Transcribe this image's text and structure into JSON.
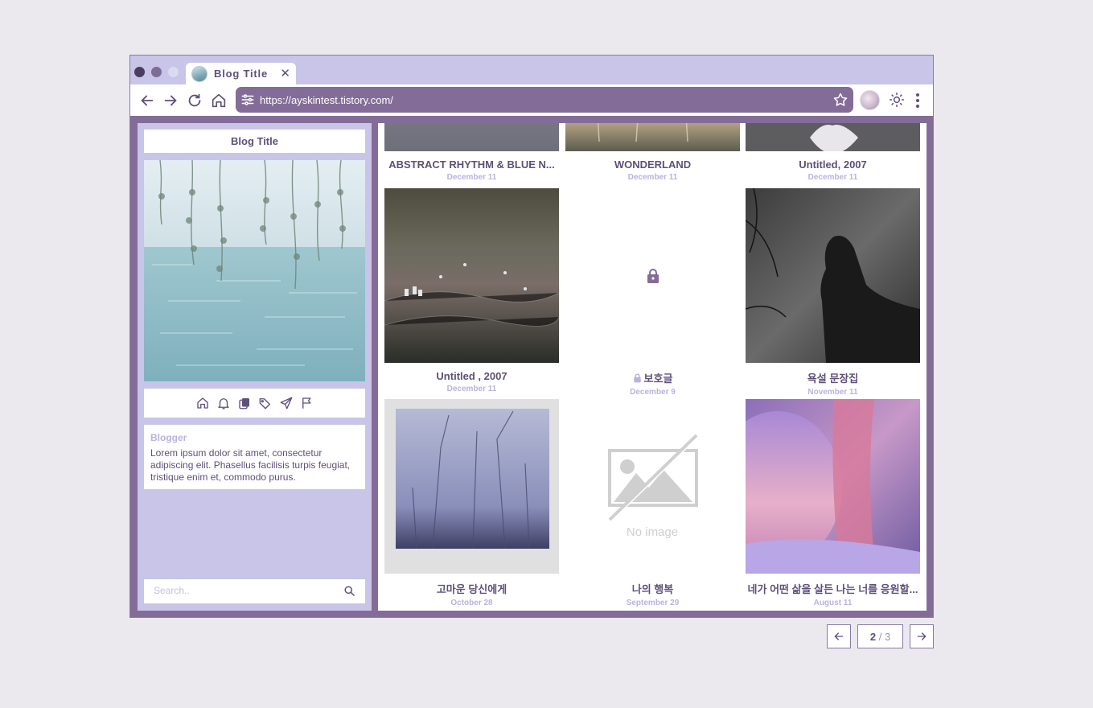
{
  "browser": {
    "tab_title": "Blog Title",
    "tab_close": "✕",
    "url": "https://ayskintest.tistory.com/"
  },
  "sidebar": {
    "blog_title": "Blog Title",
    "icons": [
      "home-icon",
      "bell-icon",
      "copy-icon",
      "tags-icon",
      "send-icon",
      "flag-icon"
    ],
    "about_name": "Blogger",
    "about_text": "Lorem ipsum dolor sit amet, consectetur adipiscing elit. Phasellus facilisis turpis feugiat, tristique enim et, commodo purus.",
    "search_placeholder": "Search.."
  },
  "posts": [
    {
      "title": "ABSTRACT RHYTHM & BLUE N...",
      "date": "December 11"
    },
    {
      "title": "WONDERLAND",
      "date": "December 11"
    },
    {
      "title": "Untitled, 2007",
      "date": "December 11"
    },
    {
      "title": "Untitled , 2007",
      "date": "December 11"
    },
    {
      "title": "보호글",
      "date": "December 9"
    },
    {
      "title": "욕설 문장집",
      "date": "November 11"
    },
    {
      "title": "고마운 당신에게",
      "date": "October 28"
    },
    {
      "title": "나의 행복",
      "date": "September 29",
      "placeholder_text": "No image"
    },
    {
      "title": "네가 어떤 삶을 살든 나는 너를 응원할...",
      "date": "August 11"
    }
  ],
  "pagination": {
    "current": "2",
    "separator": "/",
    "total": "3"
  },
  "colors": {
    "accent": "#836d98",
    "lavender": "#c8c5e8",
    "text": "#5f4f7a",
    "muted": "#b9b2e0"
  }
}
